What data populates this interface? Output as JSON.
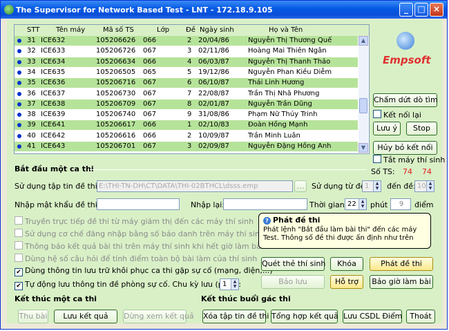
{
  "window": {
    "title": "The Supervisor for Network Based Test - LNT - 172.18.9.105",
    "min_label": "_",
    "max_label": "□",
    "close_label": "×"
  },
  "table": {
    "headers": {
      "stt": "STT",
      "name": "Tên máy",
      "ts": "Mã số TS",
      "lop": "Lớp",
      "de": "Đề",
      "dob": "Ngày sinh",
      "fullname": "Họ và Tên"
    },
    "rows": [
      {
        "stt": "31",
        "name": "ICE632",
        "ts": "105206626",
        "lop": "066",
        "de": "2",
        "dob": "20/04/86",
        "fullname": "Nguyễn Thị Thương Quế"
      },
      {
        "stt": "32",
        "name": "ICE633",
        "ts": "105206726",
        "lop": "067",
        "de": "3",
        "dob": "02/11/86",
        "fullname": "Hoàng Mai Thiên Ngân"
      },
      {
        "stt": "33",
        "name": "ICE634",
        "ts": "105206634",
        "lop": "066",
        "de": "4",
        "dob": "06/03/87",
        "fullname": "Nguyễn Thị Thanh Thảo"
      },
      {
        "stt": "34",
        "name": "ICE635",
        "ts": "105206505",
        "lop": "065",
        "de": "5",
        "dob": "19/12/86",
        "fullname": "Nguyễn Phan Kiều Diễm"
      },
      {
        "stt": "35",
        "name": "ICE636",
        "ts": "105206716",
        "lop": "067",
        "de": "6",
        "dob": "06/10/87",
        "fullname": "Thái Linh Hương"
      },
      {
        "stt": "36",
        "name": "ICE637",
        "ts": "105206730",
        "lop": "067",
        "de": "7",
        "dob": "22/08/87",
        "fullname": "Trần Thị Nhã Phương"
      },
      {
        "stt": "37",
        "name": "ICE638",
        "ts": "105206709",
        "lop": "067",
        "de": "8",
        "dob": "02/01/87",
        "fullname": "Nguyễn Trần Dũng"
      },
      {
        "stt": "38",
        "name": "ICE639",
        "ts": "105206740",
        "lop": "067",
        "de": "9",
        "dob": "31/08/86",
        "fullname": "Phạm Nữ Thúy Trinh"
      },
      {
        "stt": "39",
        "name": "ICE641",
        "ts": "105206617",
        "lop": "066",
        "de": "1",
        "dob": "02/10/83",
        "fullname": "Đoàn Hồng Mạnh"
      },
      {
        "stt": "40",
        "name": "ICE642",
        "ts": "105206616",
        "lop": "066",
        "de": "2",
        "dob": "10/09/87",
        "fullname": "Trần Minh Luân"
      },
      {
        "stt": "41",
        "name": "ICE643",
        "ts": "105206701",
        "lop": "067",
        "de": "3",
        "dob": "02/09/87",
        "fullname": "Nguyễn Đặng Hồng Anh"
      }
    ]
  },
  "right": {
    "brand": "Empsoft",
    "btn_stop_scan": "Chấm dứt dò tìm",
    "chk_reconnect": "Kết nối lại",
    "btn_note": "Lưu ý",
    "btn_stop": "Stop",
    "btn_cancel_conn": "Hủy bỏ kết nối",
    "chk_shutdown": "Tắt máy thí sinh",
    "ts_label": "Số TS:",
    "ts_count_1": "74",
    "ts_count_2": "74"
  },
  "start": {
    "title": "Bắt đầu một ca thi",
    "file_label": "Sử dụng tập tin đề thi:",
    "file_value": "E:\\THI-TN-DH\\CT\\DATA\\THI-02BTHCL\\dsss.emp",
    "use_from_label": "Sử dụng từ đề:",
    "use_from_value": "1",
    "to_label": "đến đề:",
    "to_value": "10",
    "pw_label": "Nhập mật khẩu đề thi:",
    "repw_label": "Nhập lại:",
    "time_label": "Thời gian:",
    "time_value": "22",
    "minute_label": "phút",
    "score_value": "9",
    "score_label": "điểm",
    "opt1": "Truyền trực tiếp đề thi từ máy giám thị đến các máy thí sinh",
    "opt2": "Sử dụng cơ chế đăng nhập bằng số báo danh trên máy thí sinh",
    "opt3": "Thông báo kết quả bài thi trên máy thí sinh khi hết giờ làm bài",
    "opt4": "Dùng hệ số câu hỏi để tính điểm toàn bộ bài làm của thí sinh",
    "opt5": "Dùng thông tin lưu trữ khôi phục ca thi gặp sự cố (mạng, điện,...)",
    "opt6": "Tự động lưu thông tin đề phòng sự cố. Chu kỳ lưu (phút):",
    "cycle_value": "1",
    "check_mark": "✔",
    "btn_scan": "Quét thẻ thí sinh",
    "btn_lock": "Khóa",
    "btn_send": "Phát đề thi",
    "btn_save": "Bảo lưu",
    "btn_help": "Hỗ trợ",
    "btn_keep_time": "Bảo giờ làm bài"
  },
  "tooltip": {
    "title": "Phát đề thi",
    "body": "Phát lệnh \"Bắt đầu làm bài thi\" đến các máy Test. Thông số đề thi được ấn định như trên"
  },
  "end_exam": {
    "title": "Kết thúc một ca thi",
    "btn_collect": "Thu bài",
    "btn_save_result": "Lưu kết quả",
    "btn_view_result": "Dừng xem kết quả"
  },
  "end_session": {
    "title": "Kết thúc buổi gác thi",
    "btn_delete": "Xóa tập tin đề thi",
    "btn_summary": "Tổng hợp kết quả",
    "btn_save_db": "Lưu CSDL Điểm",
    "btn_exit": "Thoát"
  }
}
